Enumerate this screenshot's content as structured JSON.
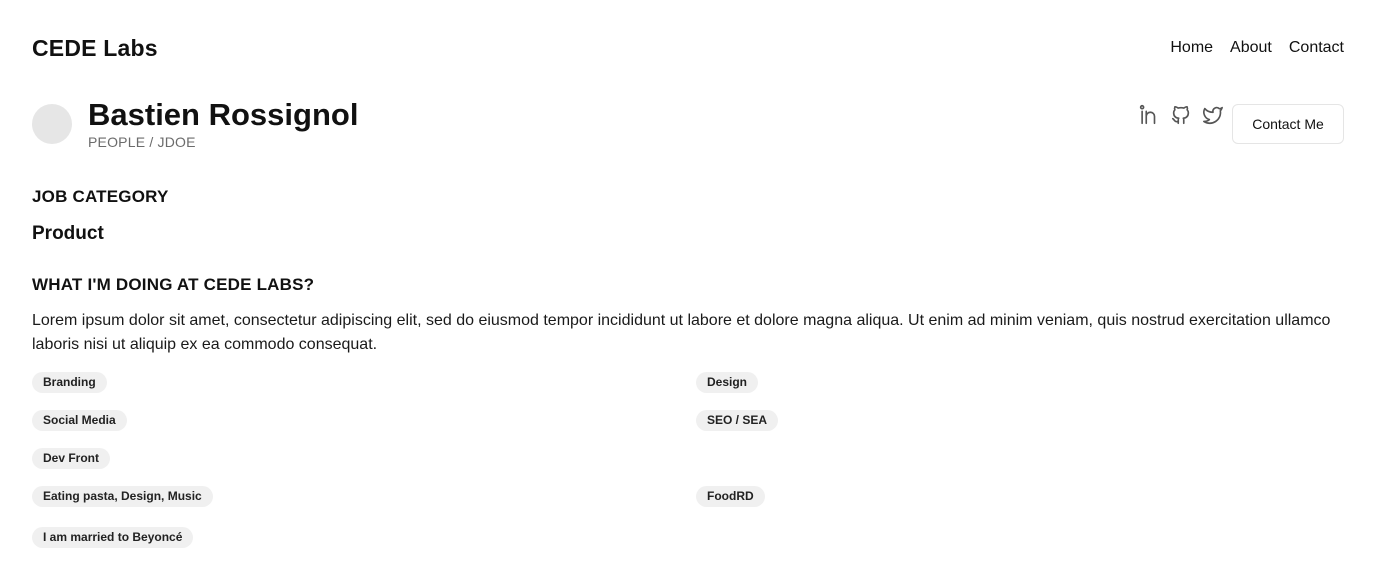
{
  "header": {
    "brand": "CEDE Labs",
    "nav": [
      "Home",
      "About",
      "Contact"
    ]
  },
  "profile": {
    "name": "Bastien Rossignol",
    "breadcrumb": "PEOPLE / JDOE",
    "social_icons": [
      "linkedin-icon",
      "github-icon",
      "twitter-icon"
    ],
    "contact_label": "Contact Me"
  },
  "job": {
    "label": "JOB CATEGORY",
    "value": "Product"
  },
  "about": {
    "label": "WHAT I'M DOING AT CEDE LABS?",
    "text": "Lorem ipsum dolor sit amet, consectetur adipiscing elit, sed do eiusmod tempor incididunt ut labore et dolore magna aliqua. Ut enim ad minim veniam, quis nostrud exercitation ullamco laboris nisi ut aliquip ex ea commodo consequat."
  },
  "tags": {
    "branding": "Branding",
    "design": "Design",
    "social_media": "Social Media",
    "seo_sea": "SEO / SEA",
    "dev_front": "Dev Front",
    "hobbies": "Eating pasta, Design, Music",
    "foodrd": "FoodRD",
    "fun_fact": "I am married to Beyoncé"
  },
  "colors": {
    "text": "#111111",
    "muted": "#6b6b6b",
    "tag_bg": "#f0f0f0",
    "avatar_bg": "#e6e6e6",
    "icon": "#555555"
  }
}
